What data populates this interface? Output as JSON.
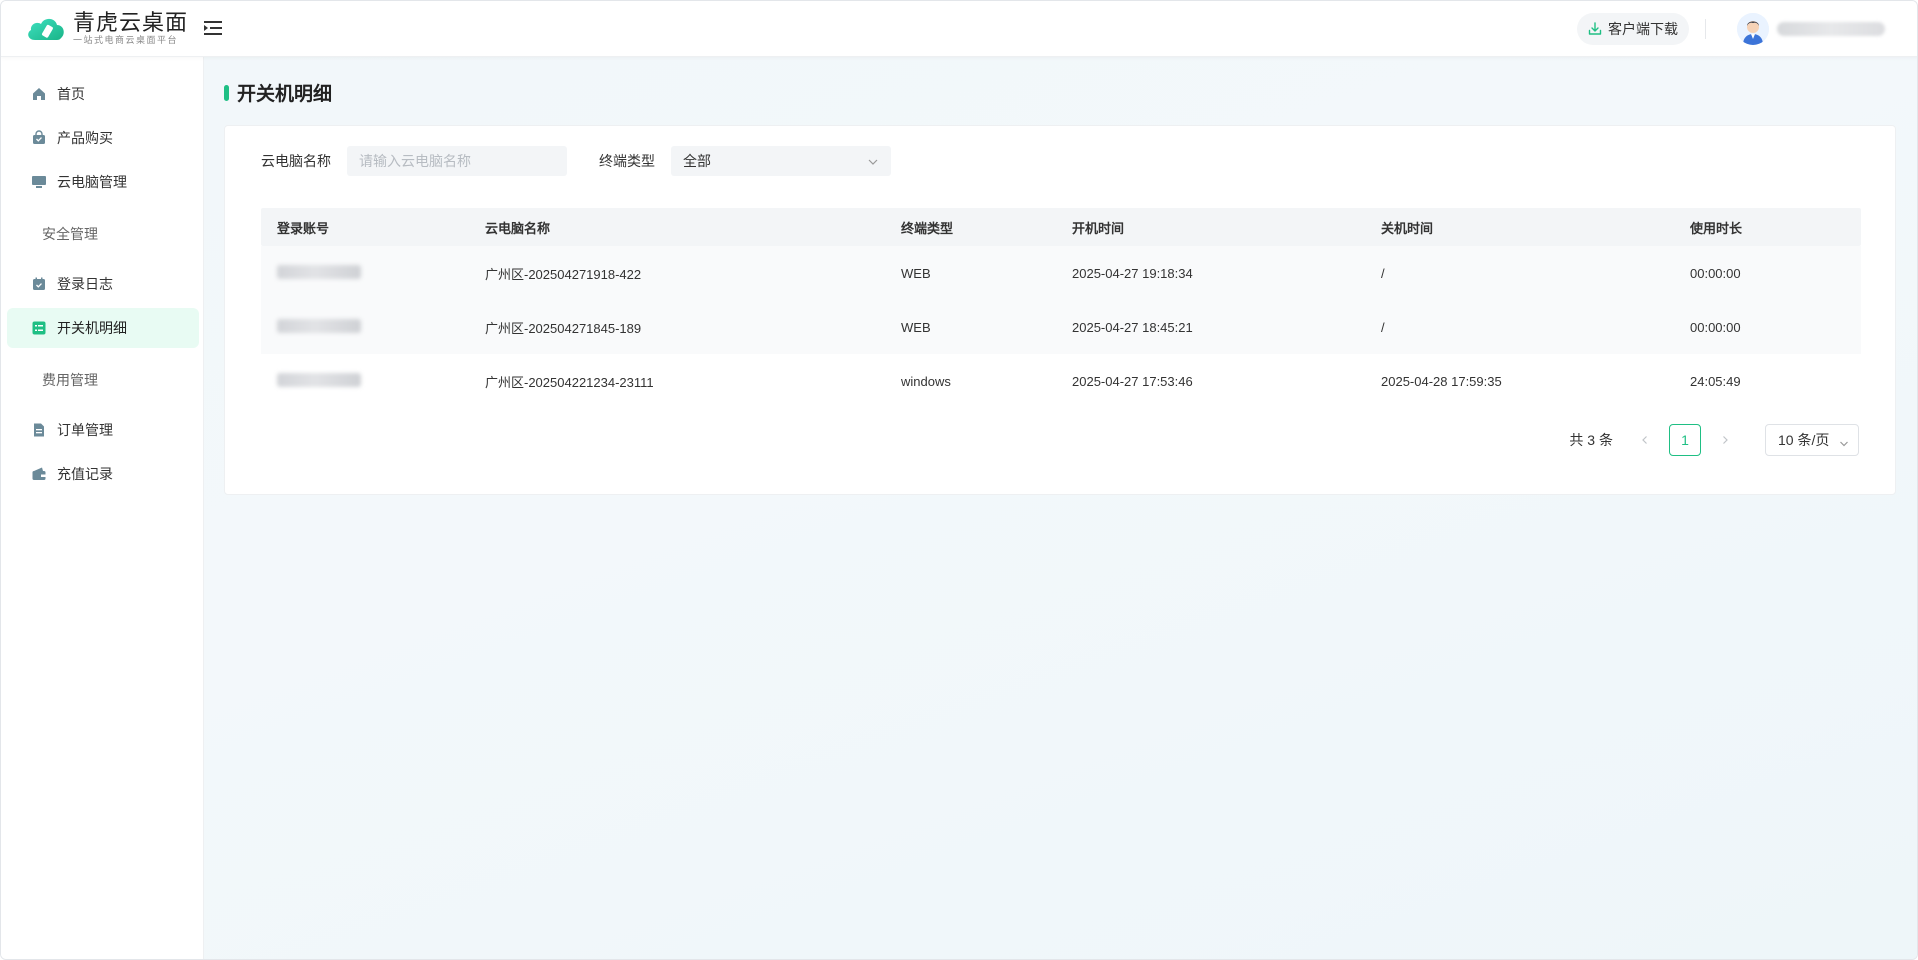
{
  "app": {
    "logo_title": "青虎云桌面",
    "logo_subtitle": "一站式电商云桌面平台",
    "accent_color": "#1fbf84"
  },
  "header": {
    "download_label": "客户端下载",
    "download_icon": "download-icon",
    "menu_toggle_icon": "menu-fold-icon"
  },
  "sidebar": {
    "items": [
      {
        "label": "首页",
        "icon": "home-icon"
      },
      {
        "label": "产品购买",
        "icon": "shopping-bag-icon"
      },
      {
        "label": "云电脑管理",
        "icon": "monitor-icon"
      },
      {
        "label": "安全管理",
        "icon": ""
      },
      {
        "label": "登录日志",
        "icon": "calendar-check-icon"
      },
      {
        "label": "开关机明细",
        "icon": "list-detail-icon",
        "active": true
      },
      {
        "label": "费用管理",
        "icon": ""
      },
      {
        "label": "订单管理",
        "icon": "document-icon"
      },
      {
        "label": "充值记录",
        "icon": "wallet-icon"
      }
    ]
  },
  "page": {
    "title": "开关机明细"
  },
  "filters": {
    "name_label": "云电脑名称",
    "name_placeholder": "请输入云电脑名称",
    "terminal_label": "终端类型",
    "terminal_value": "全部"
  },
  "table": {
    "columns": [
      "登录账号",
      "云电脑名称",
      "终端类型",
      "开机时间",
      "关机时间",
      "使用时长"
    ],
    "rows": [
      {
        "account": "",
        "name": "广州区-202504271918-422",
        "terminal": "WEB",
        "start": "2025-04-27 19:18:34",
        "end": "/",
        "duration": "00:00:00"
      },
      {
        "account": "",
        "name": "广州区-202504271845-189",
        "terminal": "WEB",
        "start": "2025-04-27 18:45:21",
        "end": "/",
        "duration": "00:00:00"
      },
      {
        "account": "",
        "name": "广州区-202504221234-23111",
        "terminal": "windows",
        "start": "2025-04-27 17:53:46",
        "end": "2025-04-28 17:59:35",
        "duration": "24:05:49"
      }
    ]
  },
  "pagination": {
    "total_text": "共 3 条",
    "current_page": "1",
    "page_size": "10 条/页"
  }
}
